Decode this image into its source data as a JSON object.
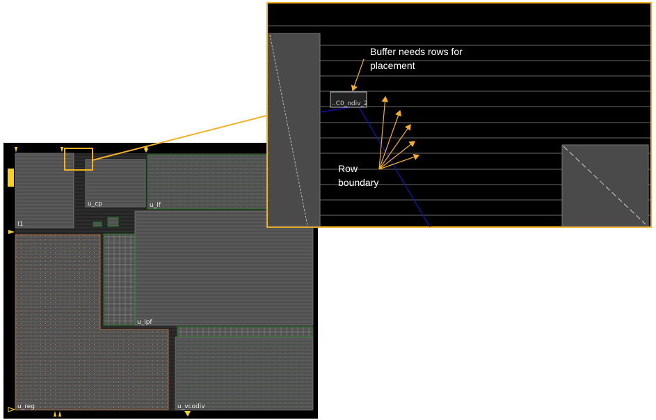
{
  "layout": {
    "blocks": [
      {
        "name": "I1"
      },
      {
        "name": "u_cp"
      },
      {
        "name": "u_lf"
      },
      {
        "name": "u_lpf"
      },
      {
        "name": "u_reg"
      },
      {
        "name": "u_vcodiv"
      }
    ]
  },
  "zoom_view": {
    "cell_label": "..C0_ndiv_2",
    "annotation_buffer": {
      "line1": "Buffer needs rows for",
      "line2": "placement"
    },
    "annotation_rows": {
      "line1": "Row",
      "line2": "boundary"
    }
  },
  "colors": {
    "highlight": "#f5b022",
    "block_fill": "#5a5a5a",
    "green_border": "#1f7a1f",
    "orange_border": "#c7743a",
    "net": "#1414c8",
    "background": "#000000"
  }
}
